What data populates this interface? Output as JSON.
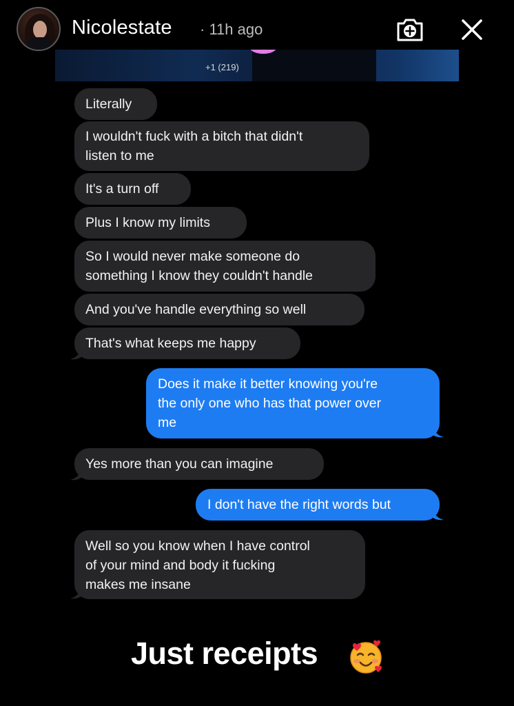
{
  "header": {
    "username": "Nicolestate",
    "time_ago": "· 11h ago",
    "add_icon": "add-circle-icon",
    "close_icon": "close-icon"
  },
  "top_strip": {
    "counter": "+1 (219)"
  },
  "messages": [
    {
      "direction": "incoming",
      "text": "Literally"
    },
    {
      "direction": "incoming",
      "text": "I wouldn't fuck with a bitch that didn't\nlisten to me"
    },
    {
      "direction": "incoming",
      "text": "It's a turn off"
    },
    {
      "direction": "incoming",
      "text": "Plus I know my limits"
    },
    {
      "direction": "incoming",
      "text": "So I would never make someone do\nsomething I know they couldn't handle"
    },
    {
      "direction": "incoming",
      "text": "And you've handle everything so well"
    },
    {
      "direction": "incoming",
      "text": "That's what keeps me happy"
    },
    {
      "direction": "outgoing",
      "text": "Does it make it better knowing you're\nthe only one who has that power over\nme"
    },
    {
      "direction": "incoming",
      "text": "Yes more than you can imagine"
    },
    {
      "direction": "outgoing",
      "text": "I don't have the right words but"
    },
    {
      "direction": "incoming",
      "text": "Well so you know when I have control\nof your mind and body it fucking\nmakes me insane"
    }
  ],
  "caption": {
    "text": "Just receipts",
    "emoji": "smiling-face-with-hearts-emoji"
  },
  "colors": {
    "background": "#000000",
    "incoming_bubble": "#262628",
    "outgoing_bubble": "#1e7cf2"
  }
}
